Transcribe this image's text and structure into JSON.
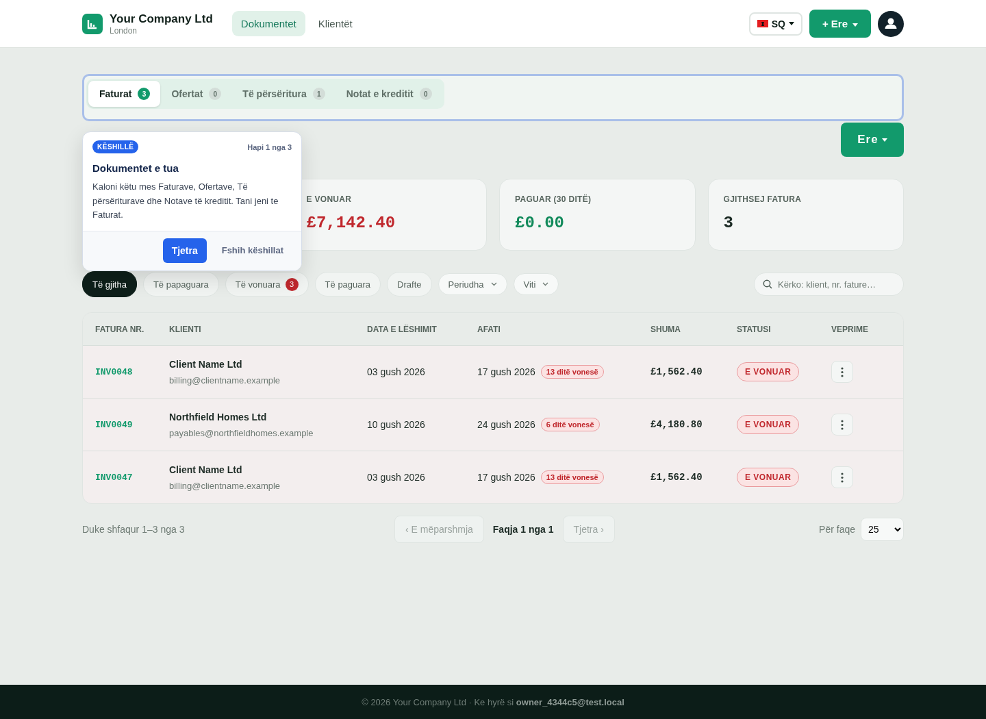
{
  "header": {
    "company": "Your Company Ltd",
    "city": "London",
    "nav": [
      {
        "label": "Dokumentet",
        "selected": true
      },
      {
        "label": "Klientët",
        "selected": false
      }
    ],
    "language": "SQ",
    "new_button": "+ Ere"
  },
  "doc_tabs": [
    {
      "label": "Faturat",
      "count": "3",
      "selected": true
    },
    {
      "label": "Ofertat",
      "count": "0",
      "selected": false
    },
    {
      "label": "Të përsëritura",
      "count": "1",
      "selected": false
    },
    {
      "label": "Notat e kreditit",
      "count": "0",
      "selected": false
    }
  ],
  "primary_button": "Ere",
  "tooltip": {
    "badge": "KËSHILLË",
    "step": "Hapi 1 nga 3",
    "title": "Dokumentet e tua",
    "body": "Kaloni këtu mes Faturave, Ofertave, Të përsëriturave dhe Notave të kreditit. Tani jeni te Faturat.",
    "next": "Tjetra",
    "hide": "Fshih këshillat"
  },
  "summary_cards": [
    {
      "label": "E VONUAR",
      "value": "£7,142.40",
      "color": "#c0282d"
    },
    {
      "label": "PAGUAR (30 DITË)",
      "value": "£0.00",
      "color": "#128a5b"
    },
    {
      "label": "GJITHSEJ FATURA",
      "value": "3",
      "color": "#1b2a24"
    }
  ],
  "filters": [
    {
      "kind": "chip",
      "label": "Të gjitha",
      "selected": true
    },
    {
      "kind": "chip",
      "label": "Të papaguara",
      "selected": false
    },
    {
      "kind": "chip",
      "label": "Të vonuara",
      "count": "3",
      "selected": false
    },
    {
      "kind": "chip",
      "label": "Të paguara",
      "selected": false
    },
    {
      "kind": "chip",
      "label": "Drafte",
      "selected": false
    },
    {
      "kind": "dropdown",
      "label": "Periudha",
      "selected": false
    },
    {
      "kind": "dropdown",
      "label": "Viti",
      "selected": false
    }
  ],
  "search": {
    "placeholder": "Kërko: klient, nr. fature…"
  },
  "table": {
    "columns": [
      "FATURA NR.",
      "KLIENTI",
      "DATA E LËSHIMIT",
      "AFATI",
      "SHUMA",
      "STATUSI",
      "VEPRIME"
    ],
    "rows": [
      {
        "number": "INV0048",
        "client": "Client Name Ltd",
        "email": "billing@clientname.example",
        "issued": "03 gush 2026",
        "due": "17 gush 2026",
        "late": "13 ditë vonesë",
        "amount": "£1,562.40",
        "status": "E VONUAR"
      },
      {
        "number": "INV0049",
        "client": "Northfield Homes Ltd",
        "email": "payables@northfieldhomes.example",
        "issued": "10 gush 2026",
        "due": "24 gush 2026",
        "late": "6 ditë vonesë",
        "amount": "£4,180.80",
        "status": "E VONUAR"
      },
      {
        "number": "INV0047",
        "client": "Client Name Ltd",
        "email": "billing@clientname.example",
        "issued": "03 gush 2026",
        "due": "17 gush 2026",
        "late": "13 ditë vonesë",
        "amount": "£1,562.40",
        "status": "E VONUAR"
      }
    ]
  },
  "pagination": {
    "summary": "Duke shfaqur 1–3 nga 3",
    "prev": {
      "label": "‹ E mëparshmja",
      "disabled": true
    },
    "page": "Faqja 1 nga 1",
    "next": {
      "label": "Tjetra ›",
      "disabled": true
    },
    "per_page_label": "Për faqe",
    "per_page": "25"
  },
  "footer": "© 2026 Your Company Ltd · Ke hyrë si **owner_4344c5@test.local**"
}
